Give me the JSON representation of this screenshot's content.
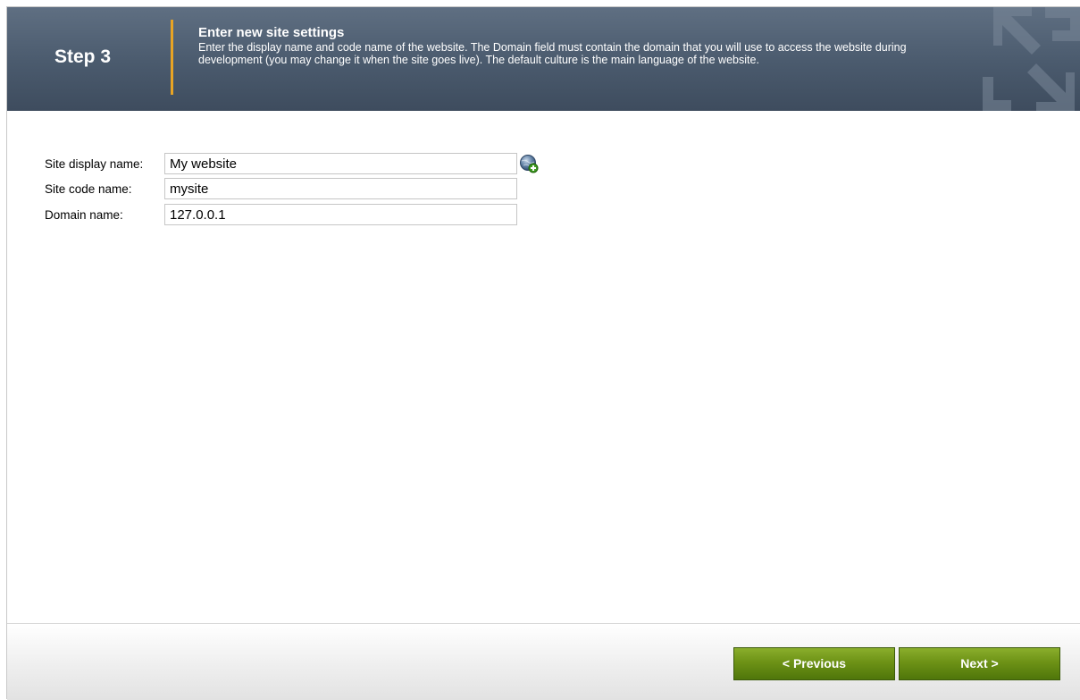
{
  "header": {
    "step": "Step 3",
    "title": "Enter new site settings",
    "description": "Enter the display name and code name of the website. The Domain field must contain the domain that you will use to access the website during development (you may change it when the site goes live). The default culture is the main language of the website.",
    "accent_color": "#e8a424",
    "background_color": "#4a5a6d"
  },
  "form": {
    "site_display_name": {
      "label": "Site display name:",
      "value": "My website",
      "action_icon": "globe-add-icon"
    },
    "site_code_name": {
      "label": "Site code name:",
      "value": "mysite"
    },
    "domain_name": {
      "label": "Domain name:",
      "value": "127.0.0.1"
    }
  },
  "footer": {
    "previous_label": "< Previous",
    "next_label": "Next >",
    "button_color": "#6d9216"
  }
}
